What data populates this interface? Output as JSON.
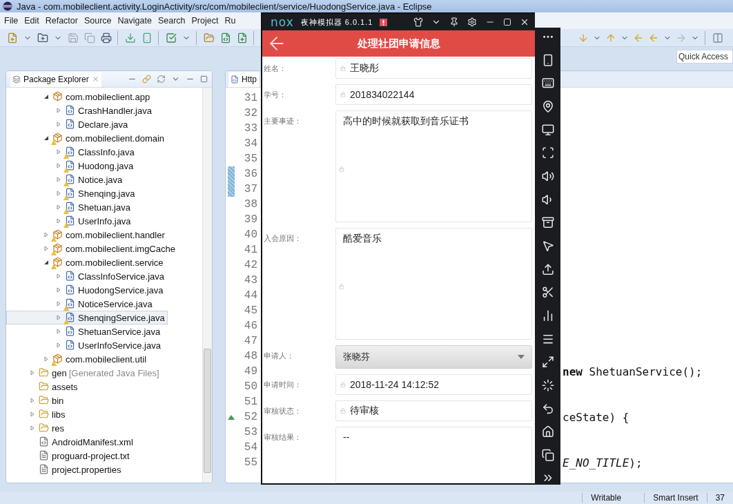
{
  "window": {
    "title": "Java - com.mobileclient.activity.LoginActivity/src/com/mobileclient/service/HuodongService.java - Eclipse"
  },
  "menu": [
    "File",
    "Edit",
    "Refactor",
    "Source",
    "Navigate",
    "Search",
    "Project",
    "Ru"
  ],
  "quick_access": {
    "placeholder": "Quick Access"
  },
  "package_explorer": {
    "title": "Package Explorer",
    "packages": [
      {
        "label": "com.mobileclient.app",
        "expanded": true,
        "warning": false,
        "children": [
          {
            "label": "CrashHandler.java",
            "expanded": false,
            "warning": false,
            "selected": false
          },
          {
            "label": "Declare.java",
            "expanded": false,
            "warning": false,
            "selected": false
          }
        ]
      },
      {
        "label": "com.mobileclient.domain",
        "expanded": true,
        "warning": true,
        "children": [
          {
            "label": "ClassInfo.java",
            "expanded": false,
            "warning": true,
            "selected": false
          },
          {
            "label": "Huodong.java",
            "expanded": false,
            "warning": true,
            "selected": false
          },
          {
            "label": "Notice.java",
            "expanded": false,
            "warning": true,
            "selected": false
          },
          {
            "label": "Shenqing.java",
            "expanded": false,
            "warning": true,
            "selected": false
          },
          {
            "label": "Shetuan.java",
            "expanded": false,
            "warning": true,
            "selected": false
          },
          {
            "label": "UserInfo.java",
            "expanded": false,
            "warning": true,
            "selected": false
          }
        ]
      },
      {
        "label": "com.mobileclient.handler",
        "expanded": false,
        "warning": true
      },
      {
        "label": "com.mobileclient.imgCache",
        "expanded": false,
        "warning": true
      },
      {
        "label": "com.mobileclient.service",
        "expanded": true,
        "warning": true,
        "children": [
          {
            "label": "ClassInfoService.java",
            "expanded": false,
            "warning": false,
            "selected": false
          },
          {
            "label": "HuodongService.java",
            "expanded": false,
            "warning": false,
            "selected": false
          },
          {
            "label": "NoticeService.java",
            "expanded": false,
            "warning": true,
            "selected": false
          },
          {
            "label": "ShenqingService.java",
            "expanded": false,
            "warning": true,
            "selected": true
          },
          {
            "label": "ShetuanService.java",
            "expanded": false,
            "warning": false,
            "selected": false
          },
          {
            "label": "UserInfoService.java",
            "expanded": false,
            "warning": false,
            "selected": false
          }
        ]
      },
      {
        "label": "com.mobileclient.util",
        "expanded": false,
        "warning": true
      }
    ],
    "resources": [
      {
        "kind": "folder",
        "label": "gen",
        "note": "[Generated Java Files]",
        "expandable": true
      },
      {
        "kind": "folder",
        "label": "assets",
        "expandable": false
      },
      {
        "kind": "folder",
        "label": "bin",
        "expandable": true
      },
      {
        "kind": "folder",
        "label": "libs",
        "expandable": true
      },
      {
        "kind": "folder",
        "label": "res",
        "expandable": true
      },
      {
        "kind": "xml",
        "label": "AndroidManifest.xml",
        "expandable": false
      },
      {
        "kind": "text",
        "label": "proguard-project.txt",
        "expandable": false
      },
      {
        "kind": "text",
        "label": "project.properties",
        "expandable": false
      }
    ]
  },
  "editor": {
    "tab": "Http",
    "lines": [
      {
        "number": "31",
        "changed": false,
        "override": false
      },
      {
        "number": "32",
        "changed": false,
        "override": false
      },
      {
        "number": "33",
        "changed": false,
        "override": false
      },
      {
        "number": "34",
        "changed": false,
        "override": false
      },
      {
        "number": "35",
        "changed": false,
        "override": false
      },
      {
        "number": "36",
        "changed": true,
        "override": false
      },
      {
        "number": "37",
        "changed": true,
        "override": false
      },
      {
        "number": "38",
        "changed": false,
        "override": false
      },
      {
        "number": "39",
        "changed": false,
        "override": false
      },
      {
        "number": "40",
        "changed": false,
        "override": false
      },
      {
        "number": "41",
        "changed": false,
        "override": false
      },
      {
        "number": "42",
        "changed": false,
        "override": false
      },
      {
        "number": "43",
        "changed": false,
        "override": false
      },
      {
        "number": "44",
        "changed": false,
        "override": false
      },
      {
        "number": "45",
        "changed": false,
        "override": false
      },
      {
        "number": "46",
        "changed": false,
        "override": false
      },
      {
        "number": "47",
        "changed": false,
        "override": false
      },
      {
        "number": "48",
        "changed": false,
        "override": false
      },
      {
        "number": "49",
        "changed": false,
        "override": false,
        "code": "**new** ShetuanService();"
      },
      {
        "number": "50",
        "changed": false,
        "override": false
      },
      {
        "number": "51",
        "changed": false,
        "override": false
      },
      {
        "number": "52",
        "changed": false,
        "override": true,
        "code": "ceState) {"
      },
      {
        "number": "53",
        "changed": false,
        "override": false
      },
      {
        "number": "54",
        "changed": false,
        "override": false
      },
      {
        "number": "55",
        "changed": false,
        "override": false,
        "code": "*E_NO_TITLE*);"
      }
    ]
  },
  "status_bar": [
    "Writable",
    "Smart Insert",
    "37"
  ],
  "emulator": {
    "logo": "nox",
    "title": "夜神模拟器 6.0.1.1",
    "app": {
      "title": "处理社团申请信息",
      "fields": [
        {
          "kind": "text",
          "label": "姓名：",
          "value": "王晓彤"
        },
        {
          "kind": "text",
          "label": "学号：",
          "value": "201834022144"
        },
        {
          "kind": "multiline",
          "label": "主要事迹：",
          "value": "高中的时候就获取到音乐证书"
        },
        {
          "kind": "multiline",
          "label": "入会原因：",
          "value": "酷爱音乐"
        },
        {
          "kind": "dropdown",
          "label": "申请人：",
          "value": "张晓芬"
        },
        {
          "kind": "text",
          "label": "申请时间：",
          "value": "2018-11-24 14:12:52"
        },
        {
          "kind": "text",
          "label": "审核状态：",
          "value": "待审核"
        },
        {
          "kind": "result",
          "label": "审核结果：",
          "value": "--"
        }
      ]
    }
  }
}
